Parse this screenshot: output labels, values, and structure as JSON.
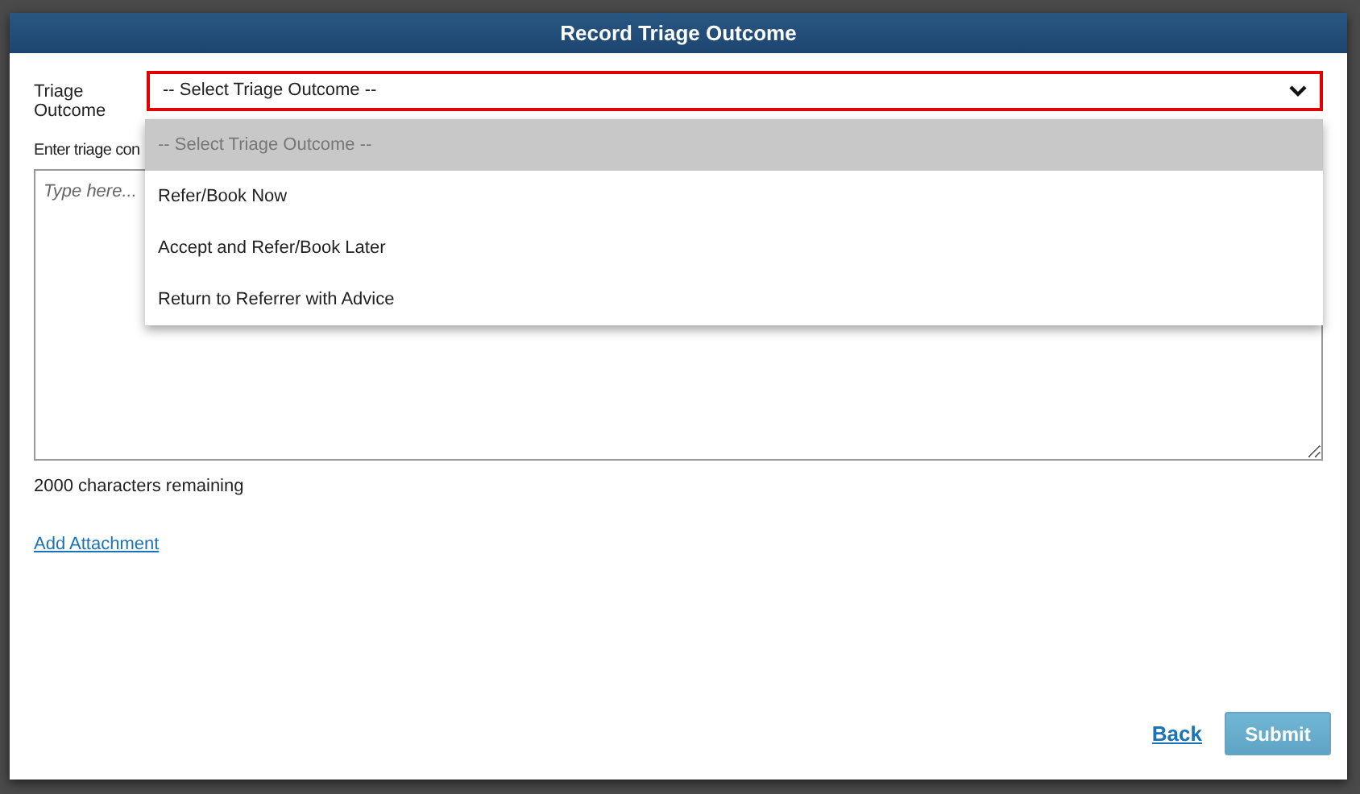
{
  "dialog": {
    "title": "Record Triage Outcome"
  },
  "triage_outcome": {
    "label": "Triage Outcome",
    "value": "-- Select Triage Outcome --",
    "invalid": true,
    "expanded": true,
    "options": [
      {
        "label": "-- Select Triage Outcome --",
        "selected": true
      },
      {
        "label": "Refer/Book Now",
        "selected": false
      },
      {
        "label": "Accept and Refer/Book Later",
        "selected": false
      },
      {
        "label": "Return to Referrer with Advice",
        "selected": false
      }
    ]
  },
  "comments": {
    "label": "Enter triage con",
    "placeholder": "Type here..."
  },
  "characters_remaining": "2000 characters remaining",
  "add_attachment": "Add Attachment",
  "buttons": {
    "back": "Back",
    "submit": {
      "label": "Submit",
      "disabled": true
    }
  }
}
